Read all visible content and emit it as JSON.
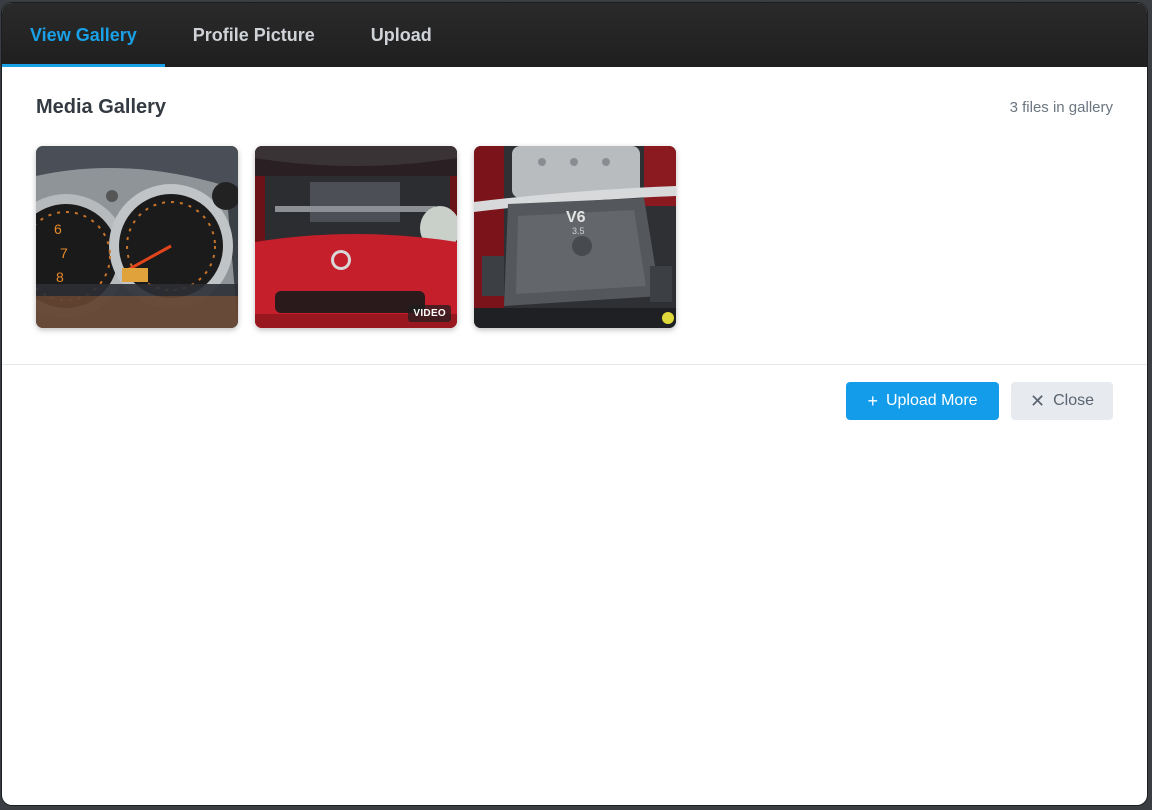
{
  "tabs": [
    {
      "label": "View Gallery",
      "active": true
    },
    {
      "label": "Profile Picture",
      "active": false
    },
    {
      "label": "Upload",
      "active": false
    }
  ],
  "gallery": {
    "title": "Media Gallery",
    "count_text": "3 files in gallery",
    "items": [
      {
        "kind": "image",
        "subject": "gauge-cluster"
      },
      {
        "kind": "video",
        "subject": "car-front-hood-open",
        "badge": "VIDEO"
      },
      {
        "kind": "image",
        "subject": "v6-engine"
      }
    ]
  },
  "footer": {
    "upload_more_label": "Upload More",
    "upload_more_icon": "plus-icon",
    "close_label": "Close",
    "close_icon": "close-icon"
  },
  "colors": {
    "accent": "#1aa0e6",
    "primary_button": "#139cea",
    "secondary_button": "#e7eaee"
  }
}
